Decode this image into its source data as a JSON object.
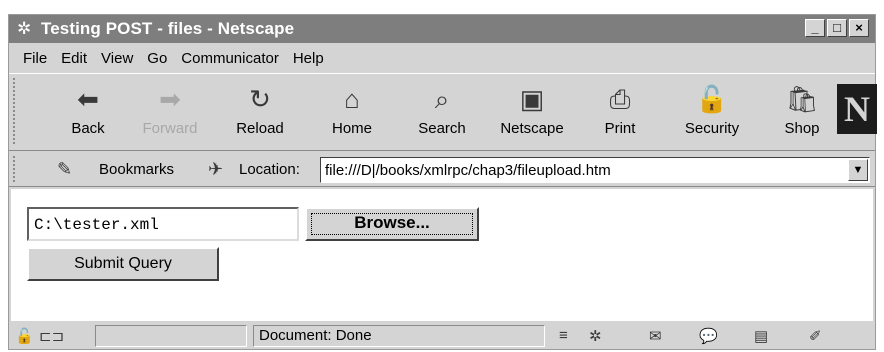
{
  "window": {
    "title": "Testing POST - files - Netscape",
    "app_icon": "netscape-web-icon"
  },
  "window_controls": {
    "minimize": "_",
    "maximize": "□",
    "close": "×"
  },
  "menu": [
    {
      "label": "File"
    },
    {
      "label": "Edit"
    },
    {
      "label": "View"
    },
    {
      "label": "Go"
    },
    {
      "label": "Communicator"
    },
    {
      "label": "Help"
    }
  ],
  "toolbar": {
    "buttons": [
      {
        "label": "Back",
        "icon": "back-arrow-icon",
        "enabled": true
      },
      {
        "label": "Forward",
        "icon": "forward-arrow-icon",
        "enabled": false
      },
      {
        "label": "Reload",
        "icon": "reload-icon",
        "enabled": true
      },
      {
        "label": "Home",
        "icon": "home-icon",
        "enabled": true
      },
      {
        "label": "Search",
        "icon": "search-icon",
        "enabled": true
      },
      {
        "label": "Netscape",
        "icon": "my-netscape-icon",
        "enabled": true
      },
      {
        "label": "Print",
        "icon": "print-icon",
        "enabled": true
      },
      {
        "label": "Security",
        "icon": "lock-icon",
        "enabled": true
      },
      {
        "label": "Shop",
        "icon": "shop-icon",
        "enabled": true
      }
    ],
    "logo": "N"
  },
  "location_bar": {
    "bookmarks_label": "Bookmarks",
    "location_label": "Location:",
    "url": "file:///D|/books/xmlrpc/chap3/fileupload.htm"
  },
  "form": {
    "file_value": "C:\\tester.xml",
    "browse_label": "Browse...",
    "submit_label": "Submit Query"
  },
  "status": {
    "text": "Document: Done"
  }
}
